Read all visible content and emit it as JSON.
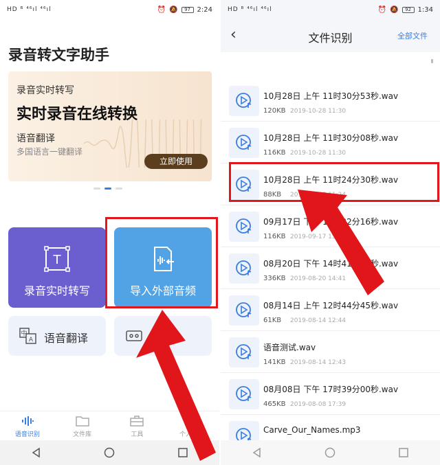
{
  "left": {
    "status": {
      "signal": "HD ᴮ ⁴⁶ıl ⁴⁶ıl",
      "time": "2:24",
      "battery": "97"
    },
    "app_title": "录音转文字助手",
    "banner": {
      "subtitle": "录音实时转写",
      "headline": "实时录音在线转换",
      "feature": "语音翻译",
      "feature_desc": "多国语言一键翻译",
      "cta": "立即使用"
    },
    "tiles": {
      "record": "录音实时转写",
      "import": "导入外部音频",
      "translate": "语音翻译",
      "other": "录制"
    },
    "tabs": [
      "语音识别",
      "文件库",
      "工具",
      "个人中心"
    ]
  },
  "right": {
    "status": {
      "signal": "HD ᴮ ⁴⁶ıl ⁴⁶ıl",
      "time": "1:34",
      "battery": "92"
    },
    "header": {
      "back": "‹",
      "title": "文件识别",
      "all_files": "全部文件"
    },
    "files": [
      {
        "name": "10月28日 上午 11时30分53秒.wav",
        "size": "120KB",
        "date": "2019-10-28 11:30"
      },
      {
        "name": "10月28日 上午 11时30分08秒.wav",
        "size": "116KB",
        "date": "2019-10-28 11:30"
      },
      {
        "name": "10月28日 上午 11时24分30秒.wav",
        "size": "88KB",
        "date": "2019-10-28 11:24"
      },
      {
        "name": "09月17日 下午 15时22分16秒.wav",
        "size": "116KB",
        "date": "2019-09-17 15:22"
      },
      {
        "name": "08月20日 下午 14时41分25秒.wav",
        "size": "336KB",
        "date": "2019-08-20 14:41"
      },
      {
        "name": "08月14日 上午 12时44分45秒.wav",
        "size": "61KB",
        "date": "2019-08-14 12:44"
      },
      {
        "name": "语音测试.wav",
        "size": "141KB",
        "date": "2019-08-14 12:43"
      },
      {
        "name": "08月08日 下午 17时39分00秒.wav",
        "size": "465KB",
        "date": "2019-08-08 17:39"
      },
      {
        "name": "Carve_Our_Names.mp3",
        "size": "",
        "date": ""
      }
    ]
  },
  "colors": {
    "accent": "#3a7de0",
    "highlight": "#e0161b",
    "record_tile": "#6b5fcf",
    "import_tile": "#52a3e6"
  }
}
